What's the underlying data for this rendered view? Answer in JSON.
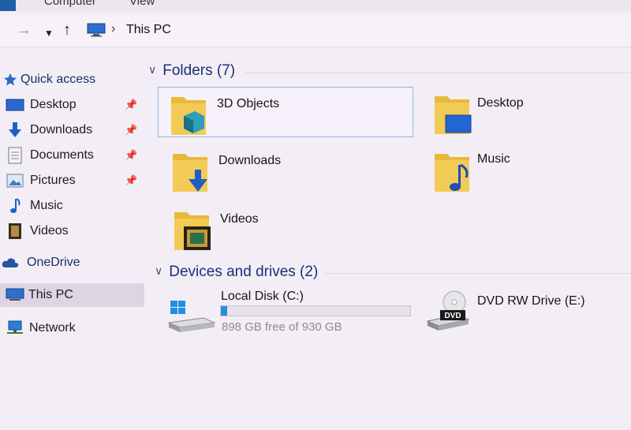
{
  "ribbon": {
    "tabs": [
      "Computer",
      "View"
    ]
  },
  "address": {
    "crumb": "This PC"
  },
  "sidebar": {
    "quick_access": "Quick access",
    "items": [
      {
        "label": "Desktop",
        "icon": "desktop-icon",
        "pinned": true
      },
      {
        "label": "Downloads",
        "icon": "downloads-icon",
        "pinned": true
      },
      {
        "label": "Documents",
        "icon": "documents-icon",
        "pinned": true
      },
      {
        "label": "Pictures",
        "icon": "pictures-icon",
        "pinned": true
      },
      {
        "label": "Music",
        "icon": "music-icon",
        "pinned": false
      },
      {
        "label": "Videos",
        "icon": "videos-icon",
        "pinned": false
      }
    ],
    "onedrive": "OneDrive",
    "this_pc": "This PC",
    "network": "Network"
  },
  "folders": {
    "header": "Folders (7)",
    "items": [
      {
        "label": "3D Objects",
        "icon": "3d-objects-folder-icon"
      },
      {
        "label": "Desktop",
        "icon": "desktop-folder-icon"
      },
      {
        "label": "Downloads",
        "icon": "downloads-folder-icon"
      },
      {
        "label": "Music",
        "icon": "music-folder-icon"
      },
      {
        "label": "Videos",
        "icon": "videos-folder-icon"
      }
    ]
  },
  "devices": {
    "header": "Devices and drives (2)",
    "local_disk": {
      "name": "Local Disk (C:)",
      "free_text": "898 GB free of 930 GB",
      "used_fraction": 0.034
    },
    "dvd": {
      "name": "DVD RW Drive (E:)",
      "badge": "DVD"
    }
  },
  "colors": {
    "accent": "#1d5fa8",
    "header_text": "#1b2f7a",
    "folder_yellow": "#e8b93a",
    "drive_bar": "#2a8fd8"
  }
}
